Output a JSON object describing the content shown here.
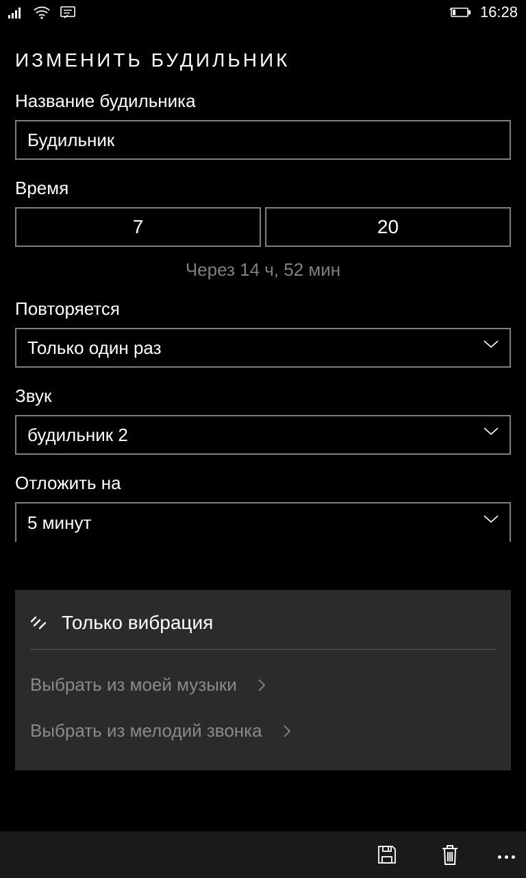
{
  "status": {
    "time": "16:28"
  },
  "pageTitle": "ИЗМЕНИТЬ БУДИЛЬНИК",
  "name": {
    "label": "Название будильника",
    "value": "Будильник"
  },
  "time": {
    "label": "Время",
    "hour": "7",
    "minute": "20",
    "caption": "Через 14 ч, 52 мин"
  },
  "repeat": {
    "label": "Повторяется",
    "value": "Только один раз"
  },
  "sound": {
    "label": "Звук",
    "value": "будильник 2"
  },
  "snooze": {
    "label": "Отложить на",
    "value": "5 минут"
  },
  "panel": {
    "vibrationOnly": "Только вибрация",
    "pickFromMusic": "Выбрать из моей музыки",
    "pickFromRingtones": "Выбрать из мелодий звонка"
  }
}
